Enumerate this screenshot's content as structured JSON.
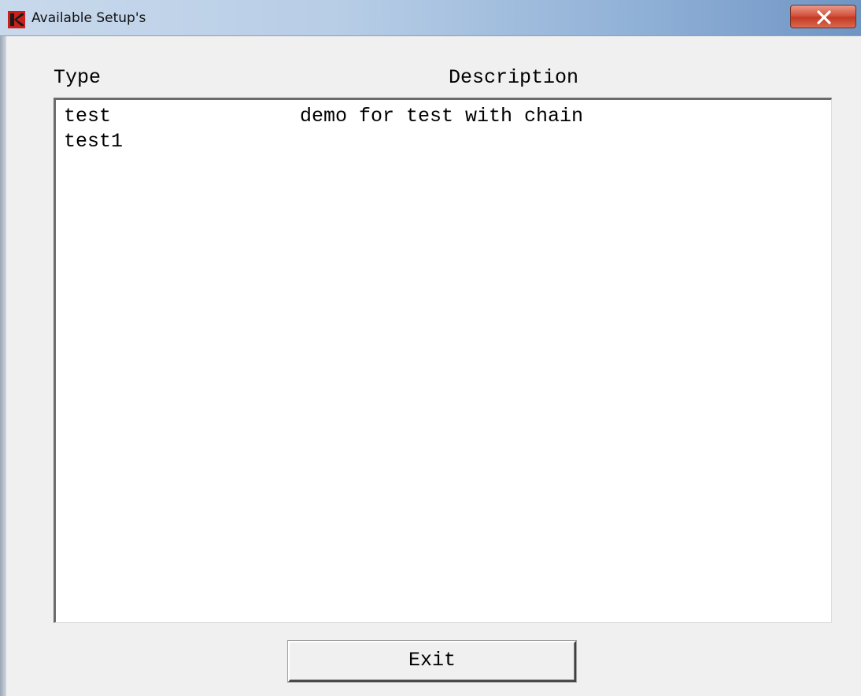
{
  "window": {
    "title": "Available Setup's"
  },
  "columns": {
    "type_header": "Type",
    "description_header": "Description"
  },
  "rows": [
    {
      "type": "test",
      "description": "demo for test with chain"
    },
    {
      "type": "test1",
      "description": ""
    }
  ],
  "buttons": {
    "exit_label": "Exit",
    "close_icon": "close-icon"
  },
  "colors": {
    "app_icon_red": "#c8201a",
    "close_button_red": "#c43a24"
  }
}
